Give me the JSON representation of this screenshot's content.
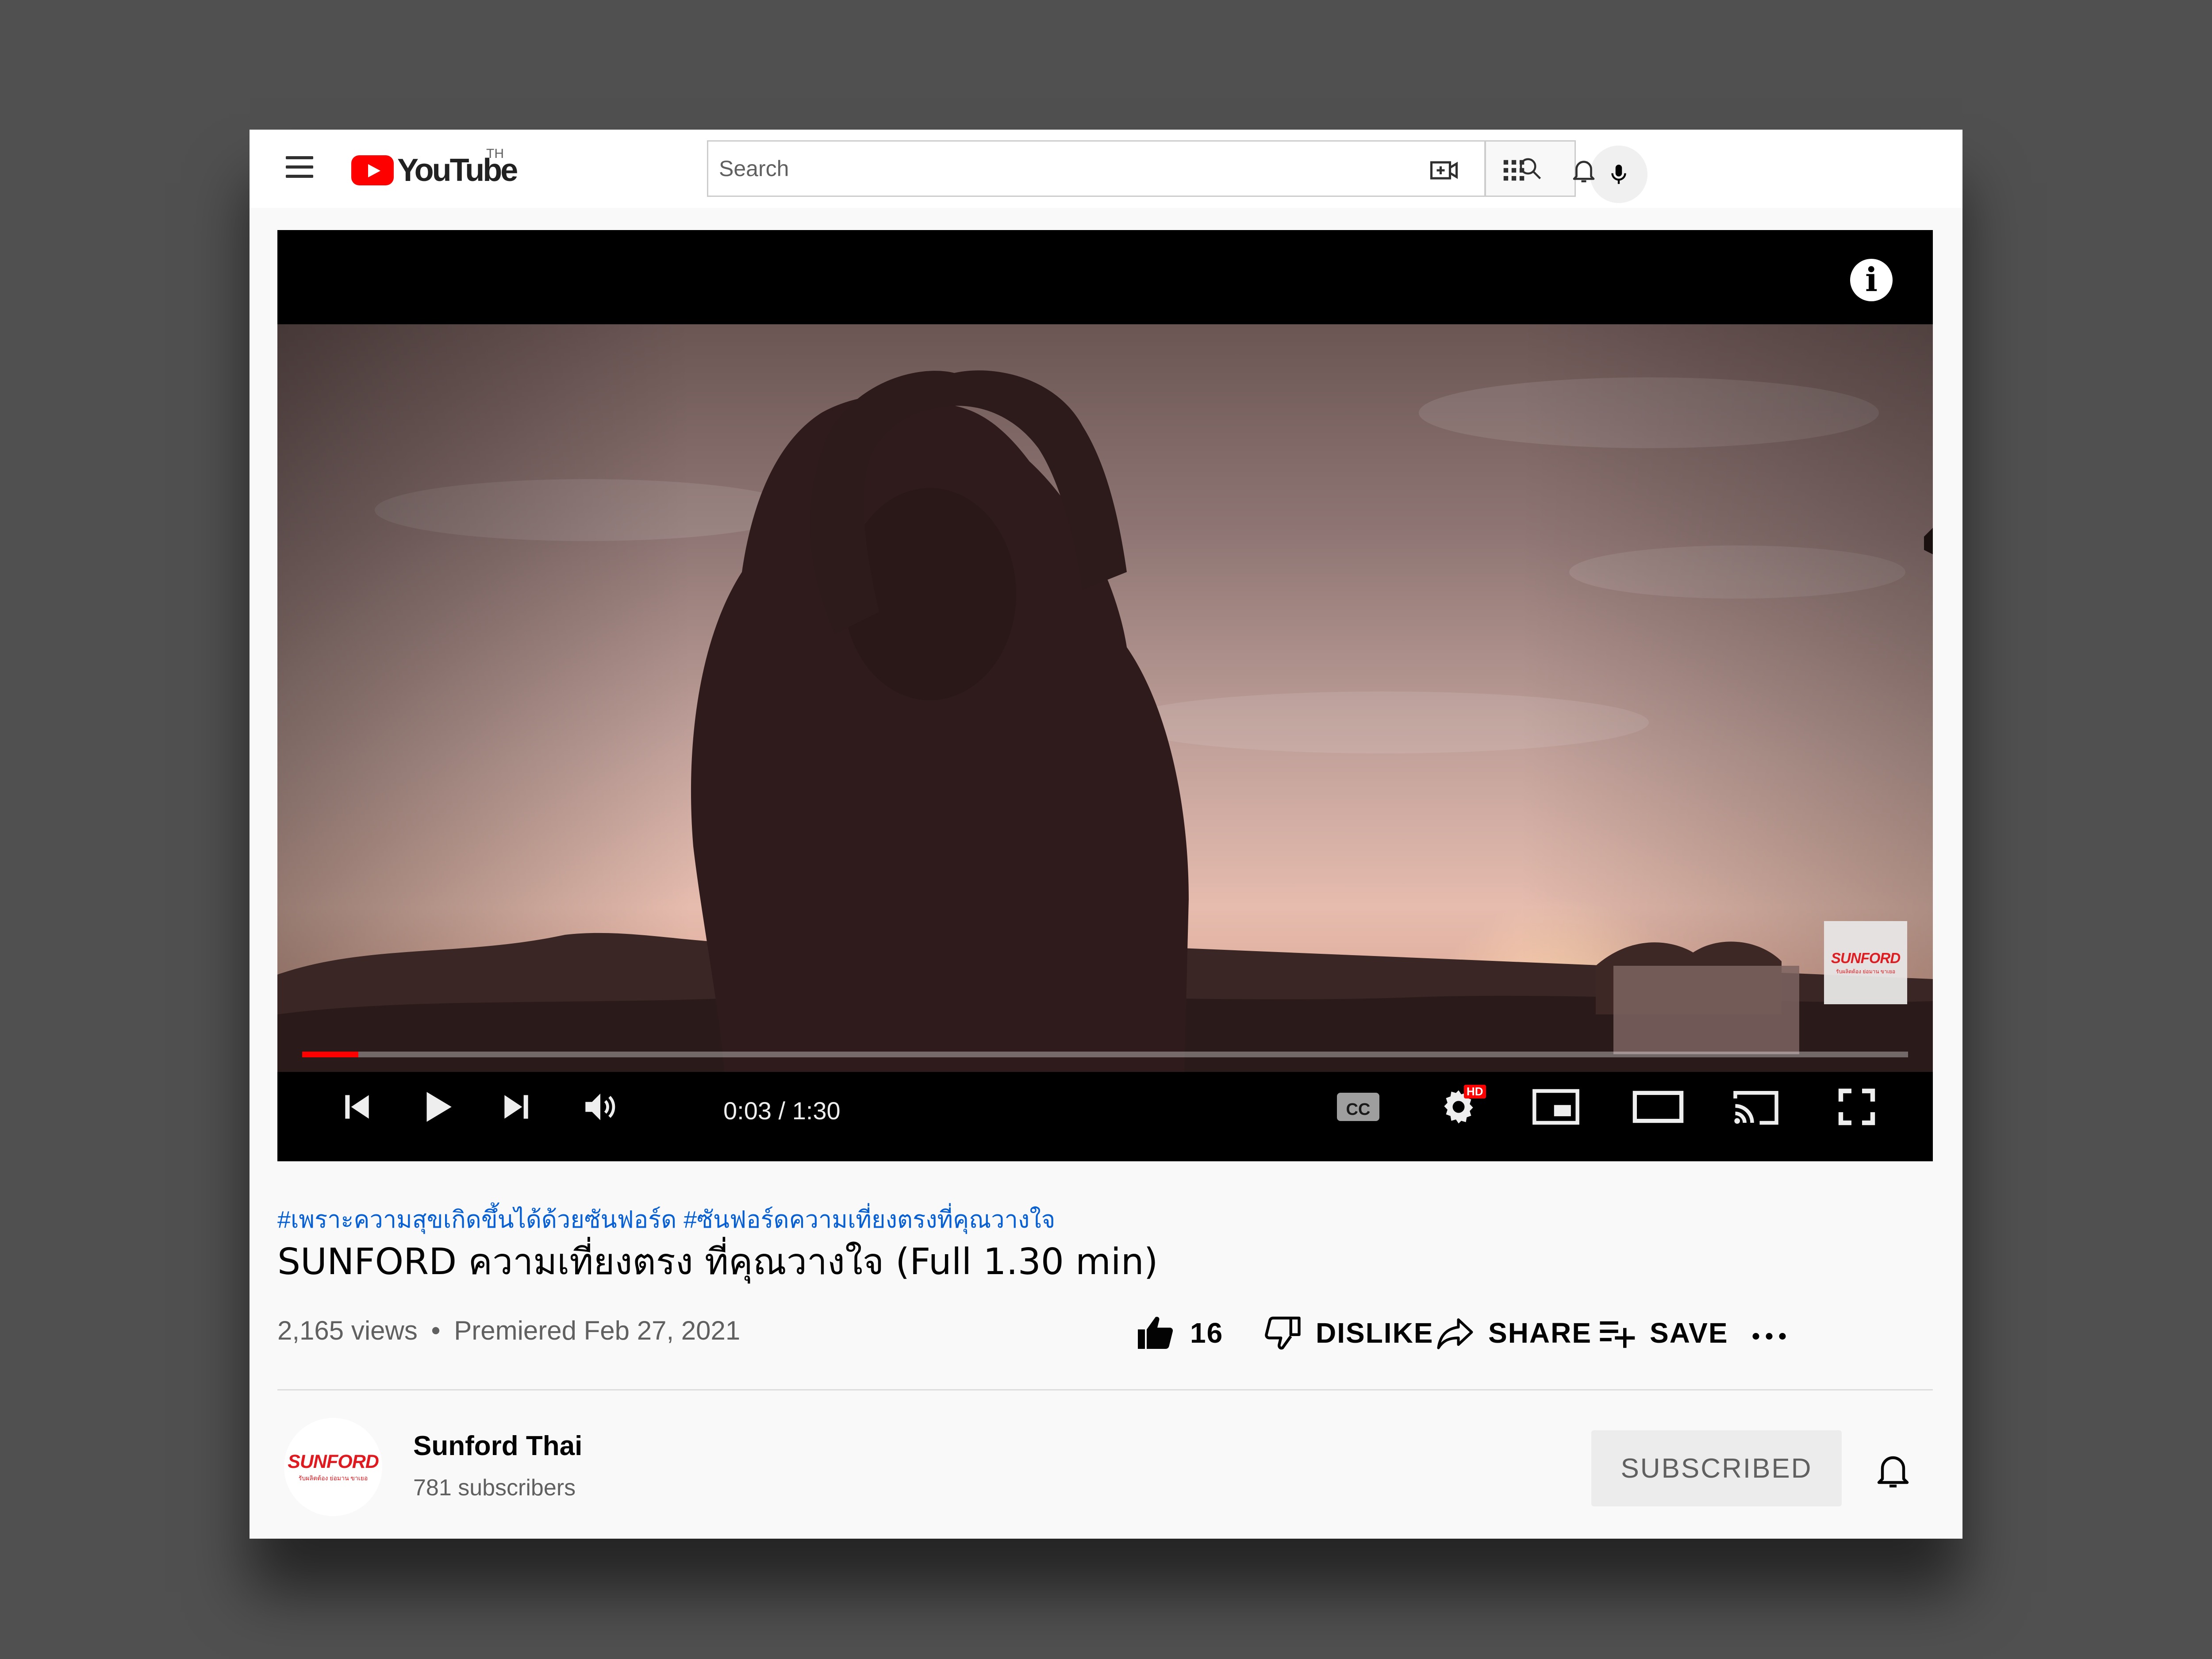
{
  "masthead": {
    "logo_text": "YouTube",
    "region": "TH",
    "search_placeholder": "Search"
  },
  "player": {
    "time_current": "0:03",
    "time_separator": " / ",
    "time_duration": "1:30",
    "progress_fraction": 0.035,
    "hd_badge": "HD",
    "watermark_name": "SUNFORD",
    "watermark_tagline": "รับผลิตต้อง ย่อมาน ขาเยอ"
  },
  "video": {
    "hashtags": [
      "#เพราะความสุขเกิดขึ้นได้ด้วยซันฟอร์ด",
      "#ซันฟอร์ดความเที่ยงตรงที่คุณวางใจ"
    ],
    "title": "SUNFORD ความเที่ยงตรง ที่คุณวางใจ (Full 1.30 min)",
    "views": "2,165 views",
    "meta_separator": "•",
    "premiered": "Premiered Feb 27, 2021",
    "like_count": "16",
    "dislike_label": "DISLIKE",
    "share_label": "SHARE",
    "save_label": "SAVE"
  },
  "channel": {
    "avatar_name": "SUNFORD",
    "avatar_tagline": "รับผลิตต้อง ย่อมาน ขาเยอ",
    "name": "Sunford Thai",
    "subscribers": "781 subscribers",
    "subscribe_label": "SUBSCRIBED"
  },
  "colors": {
    "brand_red": "#ff0000",
    "link_blue": "#065fd4",
    "sunford_red": "#e1181e"
  }
}
